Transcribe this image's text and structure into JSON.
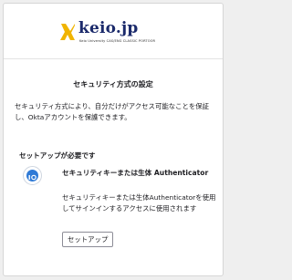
{
  "brand": {
    "logo_text": "keio.jp",
    "subtitle": "Keio University CAS/ENG CLASSIC PORTOOR",
    "accent_color": "#f0b400",
    "text_color": "#1b2a6b"
  },
  "page": {
    "title": "セキュリティ方式の設定",
    "description": "セキュリティ方式により、自分だけがアクセス可能なことを保証し、Oktaアカウントを保護できます。"
  },
  "setup_required": {
    "heading": "セットアップが必要です",
    "authenticator": {
      "icon": "security-key-icon",
      "name": "セキュリティキーまたは生体 Authenticator",
      "description": "セキュリティキーまたは生体Authenticatorを使用してサインインするアクセスに使用されます",
      "button_label": "セットアップ"
    }
  }
}
